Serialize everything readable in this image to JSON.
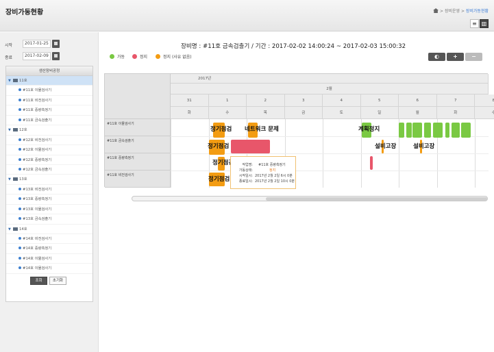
{
  "header": {
    "title": "장비가동현황",
    "breadcrumb": [
      "장비운영",
      "장비가동현황"
    ]
  },
  "search": {
    "start_label": "시작",
    "start_value": "2017-01-25",
    "end_label": "종료",
    "end_value": "2017-02-09",
    "search_btn": "조회",
    "reset_btn": "초기화"
  },
  "tree": {
    "header": "생산장비공정",
    "groups": [
      {
        "label": "11호",
        "items": [
          "#11호 이물검사기",
          "#11호 비전검사기",
          "#11호 중량측정기",
          "#11호 금속검출기"
        ]
      },
      {
        "label": "12호",
        "items": [
          "#12호 비전검사기",
          "#12호 이물검사기",
          "#12호 중량측정기",
          "#12호 금속검출기"
        ]
      },
      {
        "label": "13호",
        "items": [
          "#13호 비전검사기",
          "#13호 중량측정기",
          "#13호 이물검사기",
          "#13호 금속검출기"
        ]
      },
      {
        "label": "14호",
        "items": [
          "#14호 비전검사기",
          "#14호 중량측정기",
          "#14호 이물검사기",
          "#14호 이물검사기"
        ]
      }
    ]
  },
  "chart": {
    "title": "장비명 : #11호 금속검출기 / 기간 : 2017-02-02 14:00:24 ~ 2017-02-03 15:00:32",
    "legend": [
      {
        "label": "가동",
        "color": "#7ac943"
      },
      {
        "label": "정지",
        "color": "#e8566a"
      },
      {
        "label": "정지 (사유 없음)",
        "color": "#f39c12"
      }
    ],
    "year": "2017년",
    "month": "2월",
    "days": [
      "31",
      "1",
      "2",
      "3",
      "4",
      "5",
      "6",
      "7",
      "8",
      "9"
    ],
    "weekdays": [
      "화",
      "수",
      "목",
      "금",
      "토",
      "일",
      "월",
      "화",
      "수",
      "목"
    ],
    "rows": [
      "#11호 이물검사기",
      "#11호 금속검출기",
      "#11호 중량측정기",
      "#11호 비전검사기"
    ],
    "labels": [
      "정기점검",
      "네트워크 문제",
      "계획정지",
      "정기점검",
      "설비고장",
      "설비고장",
      "정기점검",
      "정기점검"
    ]
  },
  "tooltip": {
    "k1": "작업명:",
    "v1": "#11호 중량측정기",
    "k2": "가동상태:",
    "v2": "정지",
    "k3": "시작일시:",
    "v3": "2017년 2월 2일 6시 0분",
    "k4": "종료일시:",
    "v4": "2017년 2월 2일 10시 0분"
  },
  "toolbar": {
    "zoom_fit": "◐",
    "zoom_in": "+",
    "zoom_out": "−"
  },
  "colors": {
    "run": "#7ac943",
    "stop": "#e8566a",
    "stop_noreason": "#f39c12"
  }
}
